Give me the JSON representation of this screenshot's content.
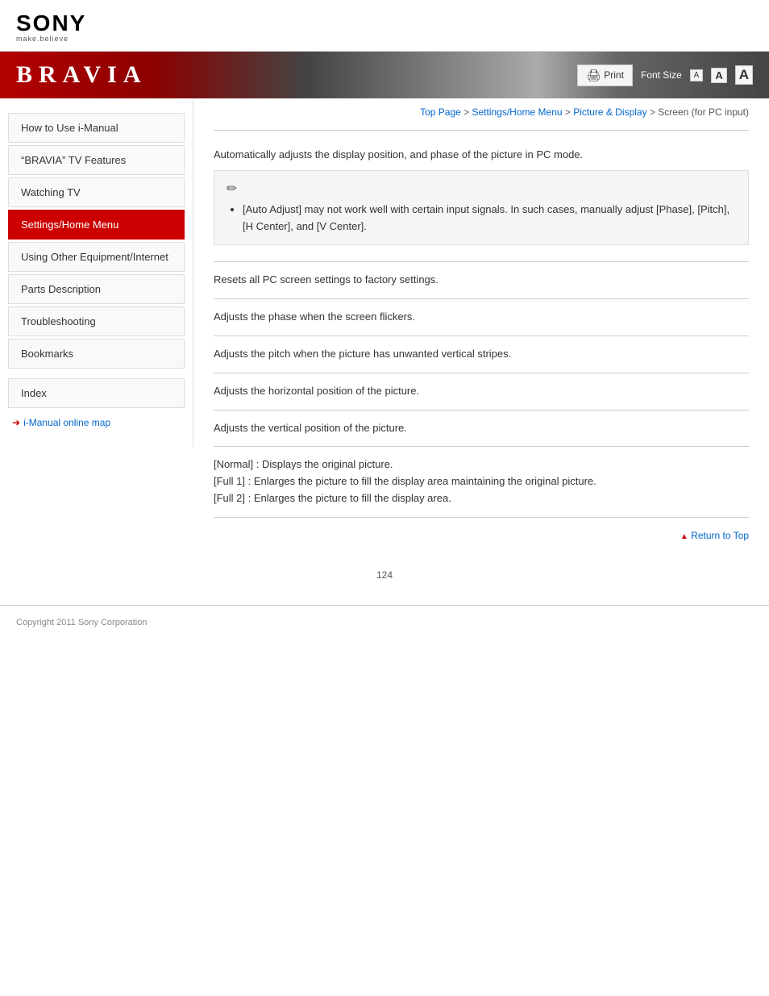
{
  "header": {
    "sony_text": "SONY",
    "sony_tagline": "make.believe"
  },
  "banner": {
    "title": "BRAVIA",
    "print_label": "Print",
    "font_size_label": "Font Size",
    "font_small": "A",
    "font_medium": "A",
    "font_large": "A"
  },
  "breadcrumb": {
    "top_page": "Top Page",
    "separator1": " > ",
    "settings": "Settings/Home Menu",
    "separator2": " > ",
    "picture_display": "Picture & Display",
    "separator3": " >",
    "current": " Screen (for PC input)"
  },
  "sidebar": {
    "items": [
      {
        "label": "How to Use i-Manual",
        "active": false
      },
      {
        "label": "“BRAVIA” TV Features",
        "active": false
      },
      {
        "label": "Watching TV",
        "active": false
      },
      {
        "label": "Settings/Home Menu",
        "active": true
      },
      {
        "label": "Using Other Equipment/Internet",
        "active": false
      },
      {
        "label": "Parts Description",
        "active": false
      },
      {
        "label": "Troubleshooting",
        "active": false
      },
      {
        "label": "Bookmarks",
        "active": false
      }
    ],
    "index_label": "Index",
    "online_map_label": "i-Manual online map"
  },
  "content": {
    "sections": [
      {
        "text": "Automatically adjusts the display position, and phase of the picture in PC mode.",
        "has_note": true,
        "note_text": "[Auto Adjust] may not work well with certain input signals. In such cases, manually adjust [Phase], [Pitch], [H Center], and [V Center]."
      },
      {
        "text": "Resets all PC screen settings to factory settings.",
        "has_note": false
      },
      {
        "text": "Adjusts the phase when the screen flickers.",
        "has_note": false
      },
      {
        "text": "Adjusts the pitch when the picture has unwanted vertical stripes.",
        "has_note": false
      },
      {
        "text": "Adjusts the horizontal position of the picture.",
        "has_note": false
      },
      {
        "text": "Adjusts the vertical position of the picture.",
        "has_note": false
      },
      {
        "text": "[Normal] : Displays the original picture.\n[Full 1] : Enlarges the picture to fill the display area maintaining the original picture.\n[Full 2] : Enlarges the picture to fill the display area.",
        "has_note": false,
        "multiline": true
      }
    ],
    "return_to_top": "Return to Top"
  },
  "footer": {
    "copyright": "Copyright 2011 Sony Corporation"
  },
  "page_number": "124"
}
